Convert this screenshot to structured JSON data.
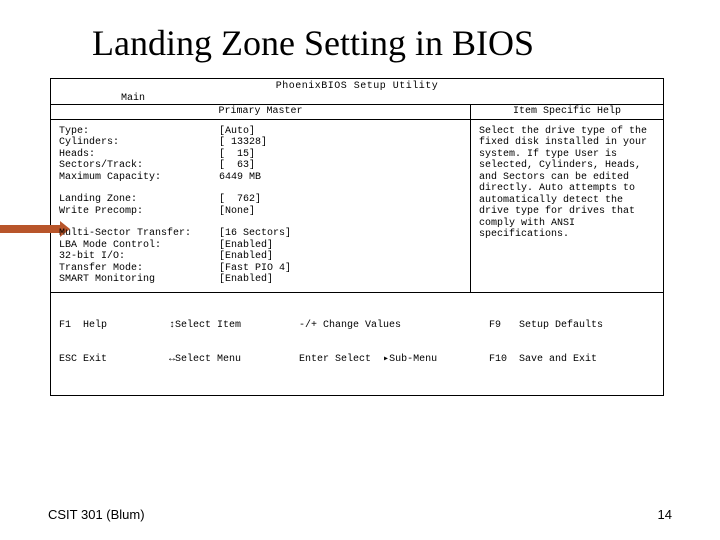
{
  "slide": {
    "title": "Landing Zone Setting in BIOS",
    "course": "CSIT 301 (Blum)",
    "pageno": "14"
  },
  "bios": {
    "utility_title": "PhoenixBIOS Setup Utility",
    "tab_main": "Main",
    "subhead_left": "Primary Master",
    "subhead_right": "Item Specific Help",
    "group1": [
      {
        "label": "Type:",
        "value": "[Auto]"
      },
      {
        "label": "Cylinders:",
        "value": "[ 13328]"
      },
      {
        "label": "Heads:",
        "value": "[  15]"
      },
      {
        "label": "Sectors/Track:",
        "value": "[  63]"
      },
      {
        "label": "Maximum Capacity:",
        "value": "6449 MB"
      }
    ],
    "group2": [
      {
        "label": "Landing Zone:",
        "value": "[  762]"
      },
      {
        "label": "Write Precomp:",
        "value": "[None]"
      }
    ],
    "group3": [
      {
        "label": "Multi-Sector Transfer:",
        "value": "[16 Sectors]"
      },
      {
        "label": "LBA Mode Control:",
        "value": "[Enabled]"
      },
      {
        "label": "32-bit I/O:",
        "value": "[Enabled]"
      },
      {
        "label": "Transfer Mode:",
        "value": "[Fast PIO 4]"
      },
      {
        "label": "SMART Monitoring",
        "value": "[Enabled]"
      }
    ],
    "help_text": "Select the drive type of the fixed disk installed in your system. If type User is selected, Cylinders, Heads, and Sectors can be edited directly.\nAuto attempts to automatically detect the drive type for drives that comply with ANSI specifications.",
    "footer": {
      "f1": "F1  Help",
      "esc": "ESC Exit",
      "sel_item": "Select Item",
      "sel_menu": "Select Menu",
      "chg_vals": "-/+ Change Values",
      "enter_sel": "Enter Select",
      "submenu": "Sub-Menu",
      "f9": "F9   Setup Defaults",
      "f10": "F10  Save and Exit"
    }
  }
}
